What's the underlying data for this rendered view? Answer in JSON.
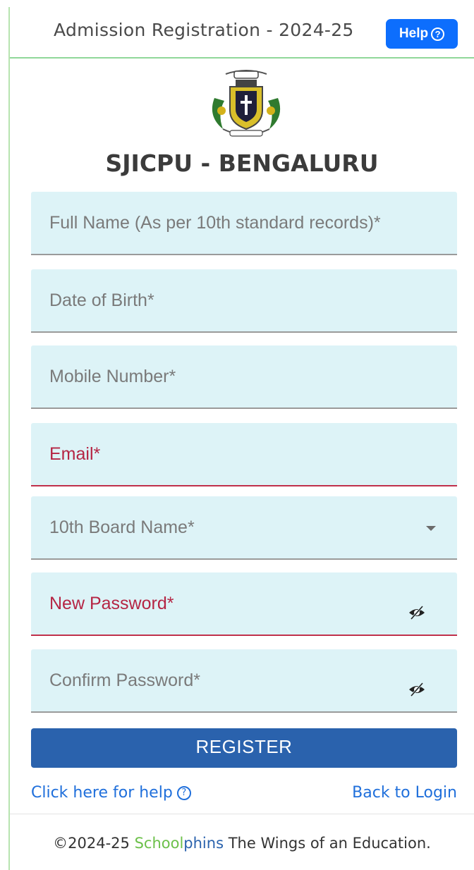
{
  "header": {
    "title": "Admission Registration - 2024-25",
    "help_label": "Help"
  },
  "logo": {
    "icon": "college-crest-logo"
  },
  "college_name": "SJICPU - BENGALURU",
  "form": {
    "full_name_placeholder": "Full Name (As per 10th standard records)*",
    "dob_placeholder": "Date of Birth*",
    "mobile_placeholder": "Mobile Number*",
    "email_placeholder": "Email*",
    "board_placeholder": "10th Board Name*",
    "new_password_placeholder": "New Password*",
    "confirm_password_placeholder": "Confirm Password*"
  },
  "register_label": "REGISTER",
  "links": {
    "help": "Click here for help",
    "back": "Back to Login"
  },
  "footer": {
    "prefix": "©2024-25 ",
    "brand_a": "School",
    "brand_b": "phins",
    "suffix": " The Wings of an Education."
  },
  "colors": {
    "field_bg": "#ddf3f7",
    "error": "#c0304a",
    "primary": "#2a62ad",
    "help_button": "#0d6efd"
  }
}
